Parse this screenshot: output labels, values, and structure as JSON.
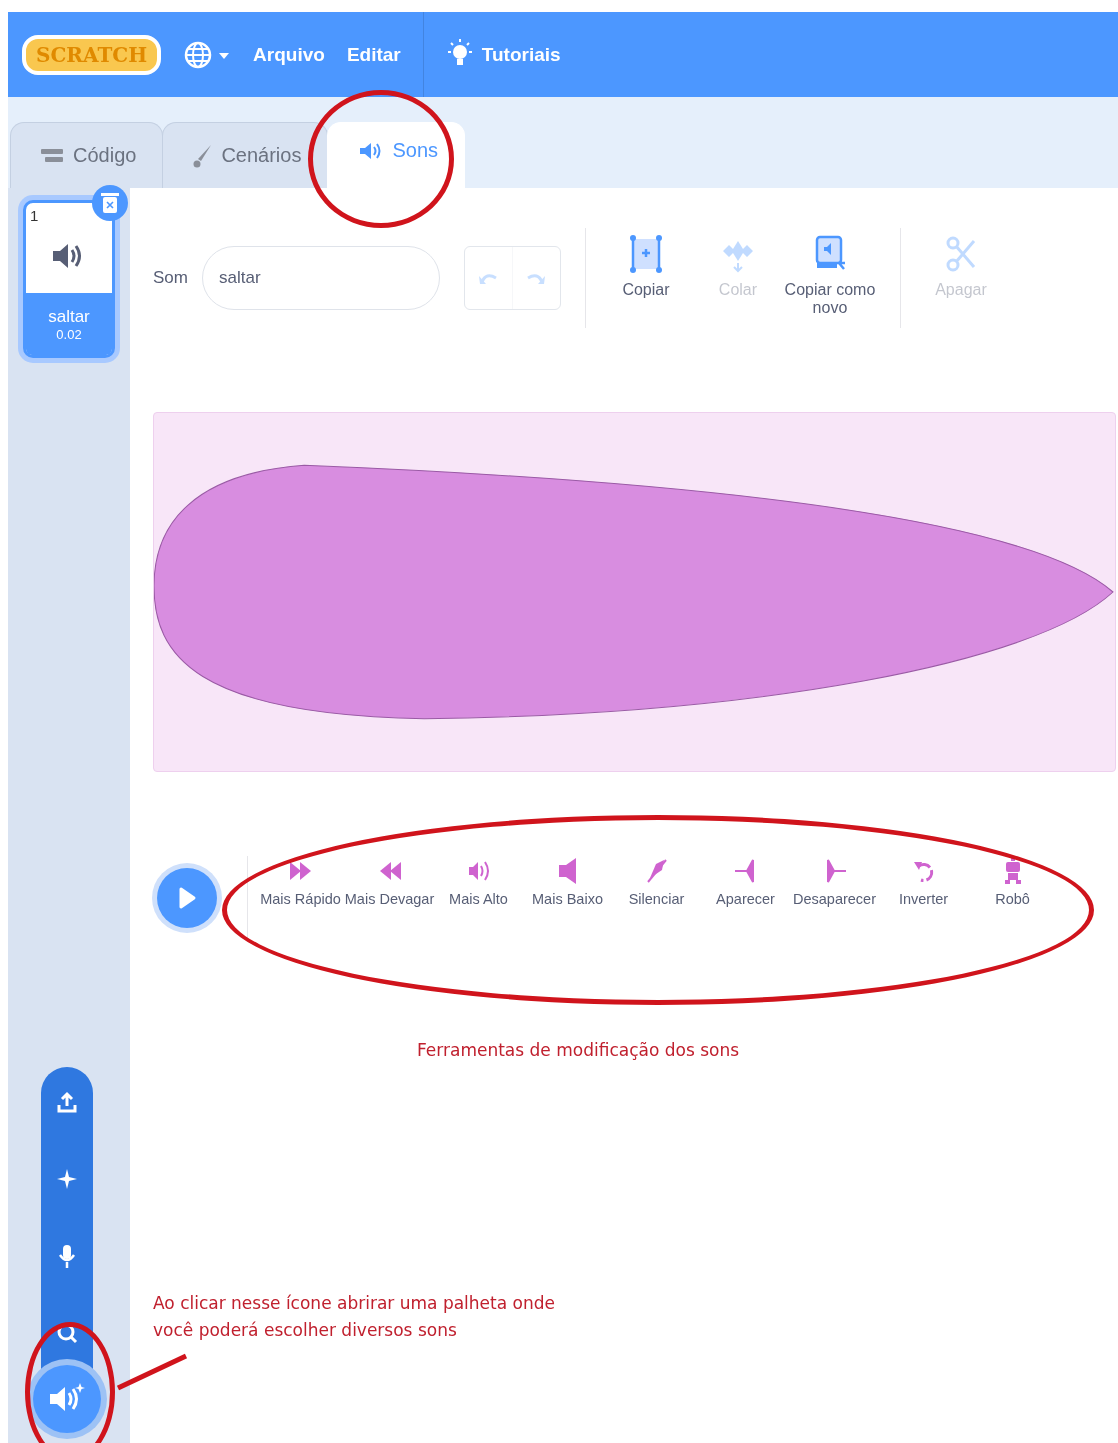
{
  "menu_bar": {
    "logo": "SCRATCH",
    "items": [
      {
        "label": "Arquivo",
        "kind": "text"
      },
      {
        "label": "Editar",
        "kind": "text"
      },
      {
        "label": "Tutoriais",
        "kind": "tutorials"
      }
    ]
  },
  "tabs": [
    {
      "label": "Código",
      "kind": "code",
      "selected": false
    },
    {
      "label": "Cenários",
      "kind": "costumes",
      "selected": false
    },
    {
      "label": "Sons",
      "kind": "sounds",
      "selected": true
    }
  ],
  "sound_list": [
    {
      "number": "1",
      "name": "saltar",
      "duration": "0.02",
      "selected": true
    }
  ],
  "editor": {
    "name_label": "Som",
    "name_value": "saltar",
    "undo_disabled": true,
    "redo_disabled": true,
    "tools": [
      {
        "label": "Copiar",
        "kind": "copy",
        "disabled": false
      },
      {
        "label": "Colar",
        "kind": "paste",
        "disabled": true
      },
      {
        "label": "Copiar como novo",
        "kind": "copy-new",
        "disabled": false
      },
      {
        "label": "Apagar",
        "kind": "delete",
        "disabled": true
      }
    ]
  },
  "effects": [
    {
      "label": "Mais Rápido",
      "kind": "faster"
    },
    {
      "label": "Mais Devagar",
      "kind": "slower"
    },
    {
      "label": "Mais Alto",
      "kind": "louder"
    },
    {
      "label": "Mais Baixo",
      "kind": "softer"
    },
    {
      "label": "Silenciar",
      "kind": "mute"
    },
    {
      "label": "Aparecer",
      "kind": "fade-in"
    },
    {
      "label": "Desaparecer",
      "kind": "fade-out"
    },
    {
      "label": "Inverter",
      "kind": "reverse"
    },
    {
      "label": "Robô",
      "kind": "robot"
    }
  ],
  "annotations": [
    {
      "text": "Ferramentas de modificação dos sons"
    },
    {
      "text": "Ao clicar nesse ícone abrirar uma palheta onde você poderá escolher diversos sons"
    }
  ]
}
